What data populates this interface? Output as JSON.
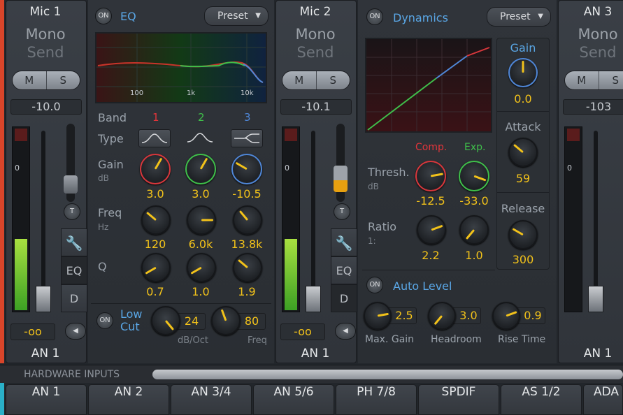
{
  "channels": [
    {
      "name": "Mic 1",
      "mode": "Mono",
      "send": "Send",
      "mute": "M",
      "solo": "S",
      "gain": "-10.0",
      "level": "-oo",
      "input": "AN 1",
      "tabs": {
        "eq": "EQ",
        "d": "D",
        "t": "T"
      }
    },
    {
      "name": "Mic 2",
      "mode": "Mono",
      "send": "Send",
      "mute": "M",
      "solo": "S",
      "gain": "-10.1",
      "level": "-oo",
      "input": "AN 1",
      "tabs": {
        "eq": "EQ",
        "d": "D",
        "t": "T"
      }
    },
    {
      "name": "AN 3",
      "mode": "Mono",
      "send": "Send",
      "mute": "M",
      "solo": "S",
      "gain": "-103",
      "input": "AN 1"
    }
  ],
  "eq": {
    "on": "ON",
    "title": "EQ",
    "preset": "Preset",
    "freq_ticks": [
      "100",
      "1k",
      "10k"
    ],
    "band_label": "Band",
    "type_label": "Type",
    "gain_label": "Gain",
    "gain_unit": "dB",
    "freq_label": "Freq",
    "freq_unit": "Hz",
    "q_label": "Q",
    "bands": [
      {
        "n": "1",
        "color": "#e0353a",
        "gain": "3.0",
        "freq": "120",
        "q": "0.7"
      },
      {
        "n": "2",
        "color": "#3fbf4a",
        "gain": "3.0",
        "freq": "6.0k",
        "q": "1.0"
      },
      {
        "n": "3",
        "color": "#4f86d6",
        "gain": "-10.5",
        "freq": "13.8k",
        "q": "1.9"
      }
    ],
    "lowcut": {
      "on": "ON",
      "label1": "Low",
      "label2": "Cut",
      "slope": "24",
      "slope_unit": "dB/Oct",
      "freq": "80",
      "freq_unit": "Freq"
    }
  },
  "dynamics": {
    "on": "ON",
    "title": "Dynamics",
    "preset": "Preset",
    "comp_label": "Comp.",
    "exp_label": "Exp.",
    "thresh_label": "Thresh.",
    "thresh_unit": "dB",
    "thresh_comp": "-12.5",
    "thresh_exp": "-33.0",
    "ratio_label": "Ratio",
    "ratio_unit": "1:",
    "ratio_comp": "2.2",
    "ratio_exp": "1.0",
    "gain_label": "Gain",
    "gain": "0.0",
    "attack_label": "Attack",
    "attack": "59",
    "release_label": "Release",
    "release": "300",
    "autolevel": {
      "on": "ON",
      "title": "Auto Level",
      "max_gain_label": "Max. Gain",
      "max_gain": "2.5",
      "headroom_label": "Headroom",
      "headroom": "3.0",
      "rise_label": "Rise Time",
      "rise": "0.9"
    }
  },
  "hardware": {
    "title": "HARDWARE INPUTS",
    "tabs": [
      "AN 1",
      "AN 2",
      "AN 3/4",
      "AN 5/6",
      "PH 7/8",
      "SPDIF",
      "AS 1/2",
      "ADA"
    ]
  },
  "colors": {
    "accent": "#f2c21a",
    "left_bar": "#d9452a",
    "bottom_bar": "#2ab0c8"
  }
}
